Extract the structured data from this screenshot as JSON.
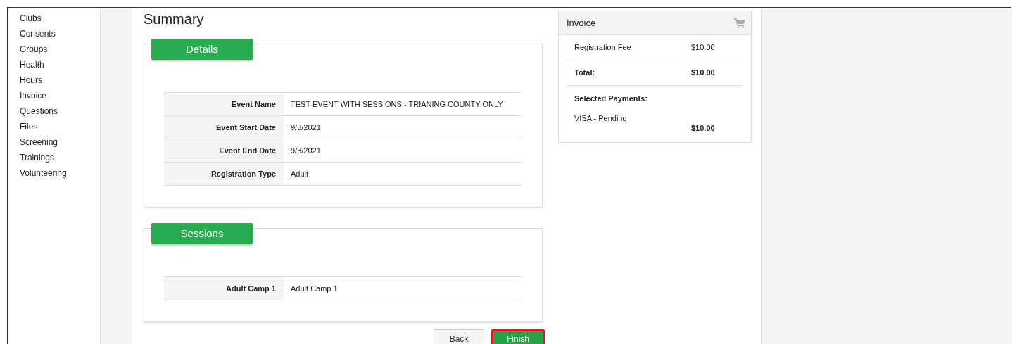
{
  "sidebar": {
    "items": [
      {
        "label": "Clubs"
      },
      {
        "label": "Consents"
      },
      {
        "label": "Groups"
      },
      {
        "label": "Health"
      },
      {
        "label": "Hours"
      },
      {
        "label": "Invoice"
      },
      {
        "label": "Questions"
      },
      {
        "label": "Files"
      },
      {
        "label": "Screening"
      },
      {
        "label": "Trainings"
      },
      {
        "label": "Volunteering"
      }
    ]
  },
  "page_title": "Summary",
  "sections": [
    {
      "title": "Details",
      "rows": [
        {
          "label": "Event Name",
          "value": "TEST EVENT WITH SESSIONS - TRIANING COUNTY ONLY"
        },
        {
          "label": "Event Start Date",
          "value": "9/3/2021"
        },
        {
          "label": "Event End Date",
          "value": "9/3/2021"
        },
        {
          "label": "Registration Type",
          "value": "Adult"
        }
      ]
    },
    {
      "title": "Sessions",
      "rows": [
        {
          "label": "Adult Camp 1",
          "value": "Adult Camp 1"
        }
      ]
    }
  ],
  "buttons": [
    {
      "label": "Back",
      "kind": "secondary",
      "highlighted": false
    },
    {
      "label": "Finish",
      "kind": "primary",
      "highlighted": true
    }
  ],
  "invoice": {
    "title": "Invoice",
    "items": [
      {
        "label": "Registration Fee",
        "amount": "$10.00"
      }
    ],
    "total_label": "Total:",
    "total": "$10.00",
    "payments_label": "Selected Payments:",
    "payments": [
      {
        "label": "VISA - Pending",
        "amount": "$10.00"
      }
    ]
  }
}
